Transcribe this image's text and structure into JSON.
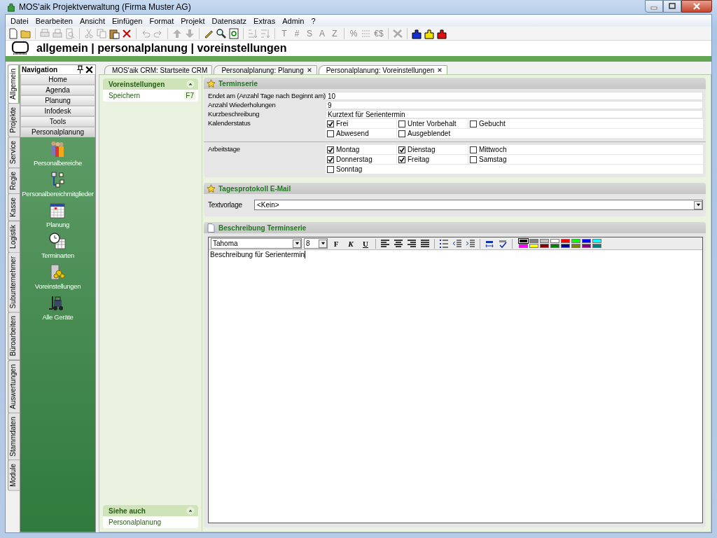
{
  "window": {
    "title": "MOS'aik Projektverwaltung (Firma Muster AG)"
  },
  "menu": [
    "Datei",
    "Bearbeiten",
    "Ansicht",
    "Einfügen",
    "Format",
    "Projekt",
    "Datensatz",
    "Extras",
    "Admin",
    "?"
  ],
  "toolbar": [
    {
      "kind": "icon",
      "disabled": false
    },
    {
      "kind": "icon",
      "disabled": false
    },
    {
      "kind": "separator"
    },
    {
      "kind": "icon",
      "disabled": true
    },
    {
      "kind": "icon",
      "disabled": true
    },
    {
      "kind": "icon",
      "disabled": true
    },
    {
      "kind": "separator"
    },
    {
      "kind": "icon",
      "disabled": true
    },
    {
      "kind": "icon",
      "disabled": true
    },
    {
      "kind": "icon",
      "disabled": false
    },
    {
      "kind": "icon",
      "disabled": false
    },
    {
      "kind": "separator"
    },
    {
      "kind": "icon",
      "disabled": true
    },
    {
      "kind": "icon",
      "disabled": true
    },
    {
      "kind": "separator"
    },
    {
      "kind": "icon",
      "disabled": true
    },
    {
      "kind": "icon",
      "disabled": true
    },
    {
      "kind": "separator"
    },
    {
      "kind": "icon",
      "disabled": false
    },
    {
      "kind": "icon",
      "disabled": false
    },
    {
      "kind": "icon",
      "disabled": false
    },
    {
      "kind": "separator"
    },
    {
      "kind": "icon",
      "disabled": true
    },
    {
      "kind": "icon",
      "disabled": true
    },
    {
      "kind": "separator"
    },
    {
      "kind": "glyph",
      "glyph": "T",
      "disabled": true
    },
    {
      "kind": "glyph",
      "glyph": "#",
      "disabled": true
    },
    {
      "kind": "glyph",
      "glyph": "S",
      "disabled": true
    },
    {
      "kind": "glyph",
      "glyph": "A",
      "disabled": true
    },
    {
      "kind": "glyph",
      "glyph": "Z",
      "disabled": true
    },
    {
      "kind": "separator"
    },
    {
      "kind": "glyph",
      "glyph": "%",
      "disabled": true
    },
    {
      "kind": "icon",
      "disabled": true
    },
    {
      "kind": "glyph",
      "glyph": "€$",
      "disabled": true
    },
    {
      "kind": "separator"
    },
    {
      "kind": "icon",
      "disabled": true
    },
    {
      "kind": "separator"
    },
    {
      "kind": "icon",
      "disabled": false
    },
    {
      "kind": "icon",
      "disabled": false
    },
    {
      "kind": "icon",
      "disabled": false
    }
  ],
  "header": {
    "breadcrumb": "allgemein | personalplanung | voreinstellungen"
  },
  "side_tabs": [
    {
      "label": "Allgemein",
      "selected": true
    },
    {
      "label": "Projekte",
      "selected": false
    },
    {
      "label": "Service",
      "selected": false
    },
    {
      "label": "Regie",
      "selected": false
    },
    {
      "label": "Kasse",
      "selected": false
    },
    {
      "label": "Logistik",
      "selected": false
    },
    {
      "label": "Subunternehmer",
      "selected": false
    },
    {
      "label": "Büroarbeiten",
      "selected": false
    },
    {
      "label": "Auswertungen",
      "selected": false
    },
    {
      "label": "Stammdaten",
      "selected": false
    },
    {
      "label": "Module",
      "selected": false
    }
  ],
  "navigation": {
    "title": "Navigation",
    "groups": [
      {
        "label": "Home",
        "selected": false
      },
      {
        "label": "Agenda",
        "selected": false
      },
      {
        "label": "Planung",
        "selected": false
      },
      {
        "label": "Infodesk",
        "selected": false
      },
      {
        "label": "Tools",
        "selected": false
      },
      {
        "label": "Personalplanung",
        "selected": true
      }
    ],
    "items": [
      {
        "label": "Personalbereiche"
      },
      {
        "label": "Personalbereichmitglieder"
      },
      {
        "label": "Planung"
      },
      {
        "label": "Terminarten"
      },
      {
        "label": "Voreinstellungen"
      },
      {
        "label": "Alle Geräte"
      }
    ]
  },
  "doc_tabs": [
    {
      "label": "MOS'aik CRM: Startseite CRM",
      "selected": false,
      "closable": false
    },
    {
      "label": "Personalplanung: Planung",
      "selected": false,
      "closable": true
    },
    {
      "label": "Personalplanung: Voreinstellungen",
      "selected": true,
      "closable": true
    }
  ],
  "task_pane": {
    "sections": [
      {
        "title": "Voreinstellungen",
        "expanded": true,
        "items": [
          {
            "label": "Speichern",
            "shortcut": "F7"
          }
        ]
      }
    ],
    "see_also": {
      "title": "Siehe auch",
      "expanded": true,
      "items": [
        {
          "label": "Personalplanung"
        }
      ]
    }
  },
  "sections": [
    {
      "kind": "form",
      "title": "Terminserie",
      "groups": [
        {
          "fields": [
            {
              "kind": "text",
              "label": "Endet am (Anzahl Tage nach Beginnt am)",
              "value": "10"
            },
            {
              "kind": "text",
              "label": "Anzahl Wiederholungen",
              "value": "9"
            },
            {
              "kind": "text",
              "label": "Kurzbeschreibung",
              "value": "Kurztext für Serientermin"
            },
            {
              "kind": "checks",
              "label": "Kalenderstatus",
              "options": [
                {
                  "label": "Frei",
                  "checked": true
                },
                {
                  "label": "Unter Vorbehalt",
                  "checked": false
                },
                {
                  "label": "Gebucht",
                  "checked": false
                },
                {
                  "label": "Abwesend",
                  "checked": false
                },
                {
                  "label": "Ausgeblendet",
                  "checked": false
                }
              ]
            }
          ]
        },
        {
          "fields": [
            {
              "kind": "checks",
              "label": "Arbeitstage",
              "options": [
                {
                  "label": "Montag",
                  "checked": true
                },
                {
                  "label": "Dienstag",
                  "checked": true
                },
                {
                  "label": "Mittwoch",
                  "checked": false
                },
                {
                  "label": "Donnerstag",
                  "checked": true
                },
                {
                  "label": "Freitag",
                  "checked": true
                },
                {
                  "label": "Samstag",
                  "checked": false
                },
                {
                  "label": "Sonntag",
                  "checked": false
                }
              ]
            }
          ]
        }
      ]
    },
    {
      "kind": "form",
      "title": "Tagesprotokoll E-Mail",
      "groups": [
        {
          "fields": [
            {
              "kind": "select",
              "label": "Textvorlage",
              "value": "<Kein>"
            }
          ]
        }
      ]
    },
    {
      "kind": "editor",
      "title": "Beschreibung Terminserie",
      "font": "Tahoma",
      "size": "8",
      "format_buttons": [
        "F",
        "K",
        "U"
      ],
      "palette": [
        {
          "color": "#000000",
          "selected": true
        },
        {
          "color": "#808080",
          "selected": false
        },
        {
          "color": "#c0c0c0",
          "selected": false
        },
        {
          "color": "#ffffff",
          "selected": false
        },
        {
          "color": "#ff0000",
          "selected": false
        },
        {
          "color": "#00ff00",
          "selected": false
        },
        {
          "color": "#0000ff",
          "selected": false
        },
        {
          "color": "#00ffff",
          "selected": false
        },
        {
          "color": "#ff00ff",
          "selected": false
        },
        {
          "color": "#ffff00",
          "selected": false
        },
        {
          "color": "#800000",
          "selected": false
        },
        {
          "color": "#008000",
          "selected": false
        },
        {
          "color": "#000080",
          "selected": false
        },
        {
          "color": "#808000",
          "selected": false
        },
        {
          "color": "#800080",
          "selected": false
        },
        {
          "color": "#008080",
          "selected": false
        }
      ],
      "text": "Beschreibung für Serientermin"
    }
  ]
}
